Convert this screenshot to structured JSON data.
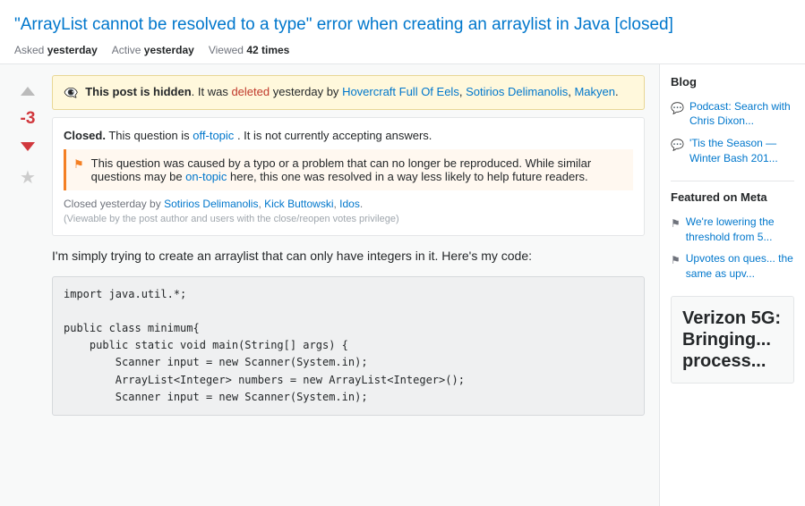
{
  "page": {
    "title": "\"ArrayList cannot be resolved to a type\" error when creating an arraylist in Java [closed]",
    "meta": {
      "asked_label": "Asked",
      "asked_value": "yesterday",
      "active_label": "Active",
      "active_value": "yesterday",
      "viewed_label": "Viewed",
      "viewed_value": "42 times"
    }
  },
  "notices": {
    "hidden": {
      "text_bold": "This post is hidden",
      "text_before_link": ". It was",
      "deleted_link_text": "deleted",
      "text_after": "yesterday by",
      "users": "Hovercraft Full Of Eels, Sotirios Delimanolis, Makyen"
    },
    "closed": {
      "label_bold": "Closed.",
      "text": " This question is ",
      "off_topic_link": "off-topic",
      "text_after": ". It is not currently accepting answers.",
      "reason_text": "This question was caused by a typo or a problem that can no longer be reproduced. While similar questions may be ",
      "on_topic_link": "on-topic",
      "reason_text2": " here, this one was resolved in a way less likely to help future readers.",
      "closed_by_label": "Closed yesterday by",
      "closed_by_users": "Sotirios Delimanolis, Kick Buttowski, Idos",
      "viewable_note": "(Viewable by the post author and users with the close/reopen votes privilege)"
    }
  },
  "question": {
    "vote_count": "-3",
    "text": "I'm simply trying to create an arraylist that can only have integers in it. Here's my code:"
  },
  "code": {
    "lines": [
      "import java.util.*;",
      "",
      "public class minimum{",
      "    public static void main(String[] args) {",
      "        Scanner input = new Scanner(System.in);",
      "        ArrayList<Integer> numbers = new ArrayList<Integer>();",
      "        Scanner input = new Scanner(System.in);"
    ]
  },
  "sidebar": {
    "blog_title": "Blog",
    "blog_items": [
      {
        "text": "Podcast: Search with Chris Dixon..."
      },
      {
        "text": "'Tis the Season — Winter Bash 201..."
      }
    ],
    "featured_title": "Featured on Meta",
    "featured_items": [
      {
        "text": "We're lowering the threshold from 5..."
      },
      {
        "text": "Upvotes on ques... the same as upv..."
      }
    ],
    "ad_title": "Verizon 5G: Bringing... process..."
  },
  "icons": {
    "up_arrow": "▲",
    "down_arrow": "▼",
    "star": "★",
    "eye_slash": "👁",
    "flag": "⚑",
    "chat_bubble": "💬",
    "flag_small": "⚐",
    "external": "↗"
  },
  "colors": {
    "vote_down_color": "#d1383d",
    "link_color": "#0077cc",
    "deleted_color": "#c0392b",
    "notice_bg": "#fff8dc",
    "code_bg": "#eff0f1",
    "sidebar_bg": "#f8f9f9"
  }
}
